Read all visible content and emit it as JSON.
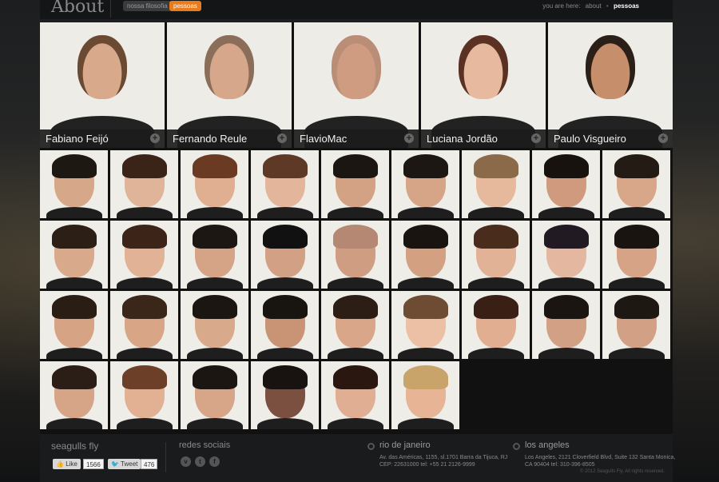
{
  "header": {
    "title": "About",
    "tabs": [
      {
        "label": "nossa filosofia",
        "active": false
      },
      {
        "label": "pessoas",
        "active": true
      }
    ],
    "breadcrumb": {
      "prefix": "you are here:",
      "items": [
        "about",
        "pessoas"
      ]
    },
    "accent_color": "#e87b1e"
  },
  "featured": [
    {
      "name": "Fabiano Feijó",
      "hair": "#6b4a34",
      "skin": "#d9a98c"
    },
    {
      "name": "Fernando Reule",
      "hair": "#8b6e5a",
      "skin": "#d6a78a"
    },
    {
      "name": "FlavioMac",
      "hair": "#b98d76",
      "skin": "#cf9c82"
    },
    {
      "name": "Luciana Jordão",
      "hair": "#5a3122",
      "skin": "#e7b99e"
    },
    {
      "name": "Paulo Visgueiro",
      "hair": "#2b2018",
      "skin": "#c78e6c"
    }
  ],
  "people_rows": [
    [
      {
        "hair": "#1e1812",
        "skin": "#d7a78a"
      },
      {
        "hair": "#3a2418",
        "skin": "#e0b499"
      },
      {
        "hair": "#6a3b22",
        "skin": "#e0ae90"
      },
      {
        "hair": "#5e3a26",
        "skin": "#e3b59b"
      },
      {
        "hair": "#1b1612",
        "skin": "#d3a183"
      },
      {
        "hair": "#1d1713",
        "skin": "#d6a486"
      },
      {
        "hair": "#8a6a48",
        "skin": "#e6b89c"
      },
      {
        "hair": "#17120e",
        "skin": "#cf9a7d"
      },
      {
        "hair": "#241b14",
        "skin": "#d8a689"
      }
    ],
    [
      {
        "hair": "#2b1f16",
        "skin": "#d9a98b"
      },
      {
        "hair": "#3c2418",
        "skin": "#e1b296"
      },
      {
        "hair": "#1d1713",
        "skin": "#d5a385"
      },
      {
        "hair": "#111111",
        "skin": "#d2a084"
      },
      {
        "hair": "#b48872",
        "skin": "#cf9d82"
      },
      {
        "hair": "#1a1410",
        "skin": "#d3a082"
      },
      {
        "hair": "#4a2c1c",
        "skin": "#e2b296"
      },
      {
        "hair": "#211a22",
        "skin": "#e3b7a0"
      },
      {
        "hair": "#1a1410",
        "skin": "#d7a386"
      }
    ],
    [
      {
        "hair": "#2a1d14",
        "skin": "#d6a384"
      },
      {
        "hair": "#3a2719",
        "skin": "#d9a587"
      },
      {
        "hair": "#1c1612",
        "skin": "#d9a98c"
      },
      {
        "hair": "#181410",
        "skin": "#c99476"
      },
      {
        "hair": "#2c1e14",
        "skin": "#d9a689"
      },
      {
        "hair": "#6d4c33",
        "skin": "#ebc0a4"
      },
      {
        "hair": "#3a2014",
        "skin": "#e1ae92"
      },
      {
        "hair": "#1b1511",
        "skin": "#d1a085"
      },
      {
        "hair": "#1e1813",
        "skin": "#d2a084"
      }
    ],
    [
      {
        "hair": "#2a1e16",
        "skin": "#d6a588"
      },
      {
        "hair": "#6b3f28",
        "skin": "#e2b093"
      },
      {
        "hair": "#1c1612",
        "skin": "#d7a588"
      },
      {
        "hair": "#181210",
        "skin": "#7b5040"
      },
      {
        "hair": "#2a1810",
        "skin": "#e0ae92"
      },
      {
        "hair": "#c9a46a",
        "skin": "#e7b596"
      }
    ]
  ],
  "footer": {
    "brand": "seagulls fly",
    "like_label": "Like",
    "like_count": "1566",
    "tweet_label": "Tweet",
    "tweet_count": "476",
    "social_title": "redes sociais",
    "social_icons": [
      "v",
      "t",
      "f"
    ],
    "locations": [
      {
        "title": "rio de janeiro",
        "line1": "Av. das Américas, 1155, sl.1701 Barra da Tijuca, RJ",
        "line2": "CEP: 22631000 tel: +55 21 2126-9999"
      },
      {
        "title": "los angeles",
        "line1": "Los Angeles, 2121 Cloverfield Blvd, Suite 132 Santa Monica,",
        "line2": "CA 90404 tel: 310-396-8505"
      }
    ],
    "copyright": "© 2012 Seagulls Fly. All rights reserved."
  }
}
